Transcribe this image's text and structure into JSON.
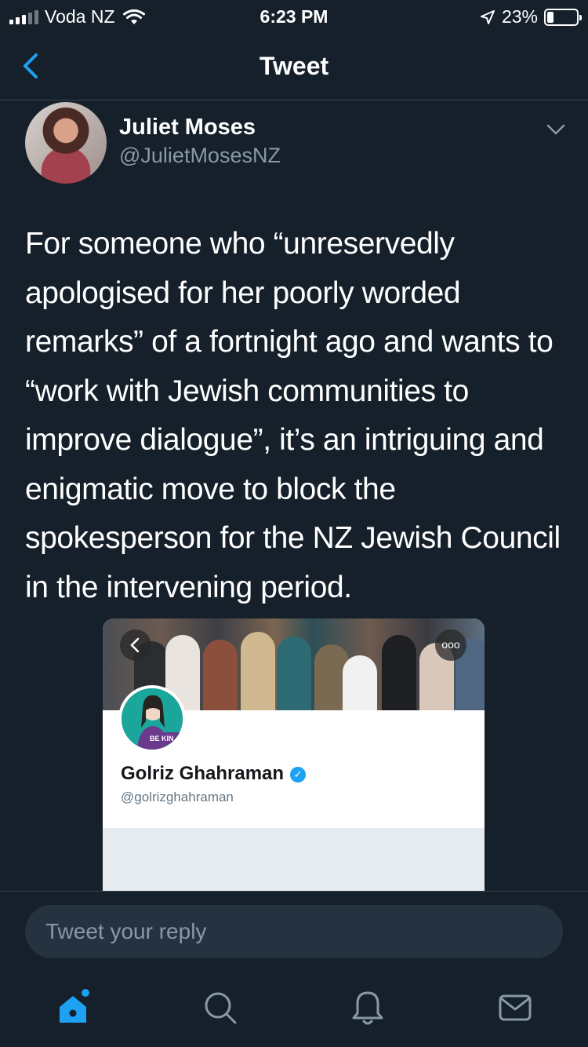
{
  "status_bar": {
    "carrier": "Voda NZ",
    "time": "6:23 PM",
    "battery_percent": "23%",
    "battery_level": 0.23,
    "icons": [
      "signal-icon",
      "wifi-icon",
      "location-icon",
      "battery-icon"
    ]
  },
  "nav": {
    "title": "Tweet",
    "back_icon": "chevron-left-icon"
  },
  "tweet": {
    "author_name": "Juliet Moses",
    "author_handle": "@JulietMosesNZ",
    "text": "For someone who “unreservedly apologised for her poorly worded remarks” of a fortnight ago and wants to “work with Jewish communities to improve dialogue”, it’s an intriguing and enigmatic move to block the spokesperson for the NZ Jewish Council in the intervening period."
  },
  "media": {
    "profile_name": "Golriz Ghahraman",
    "profile_handle": "@golrizghahraman",
    "avatar_badge": "BE KIN",
    "more_label": "ooo"
  },
  "reply": {
    "placeholder": "Tweet your reply"
  },
  "tab_bar": {
    "tabs": [
      "home-icon",
      "search-icon",
      "notifications-icon",
      "messages-icon"
    ]
  },
  "colors": {
    "background": "#15202b",
    "divider": "#38444d",
    "accent": "#1da1f2",
    "secondary_text": "#8899a6"
  }
}
